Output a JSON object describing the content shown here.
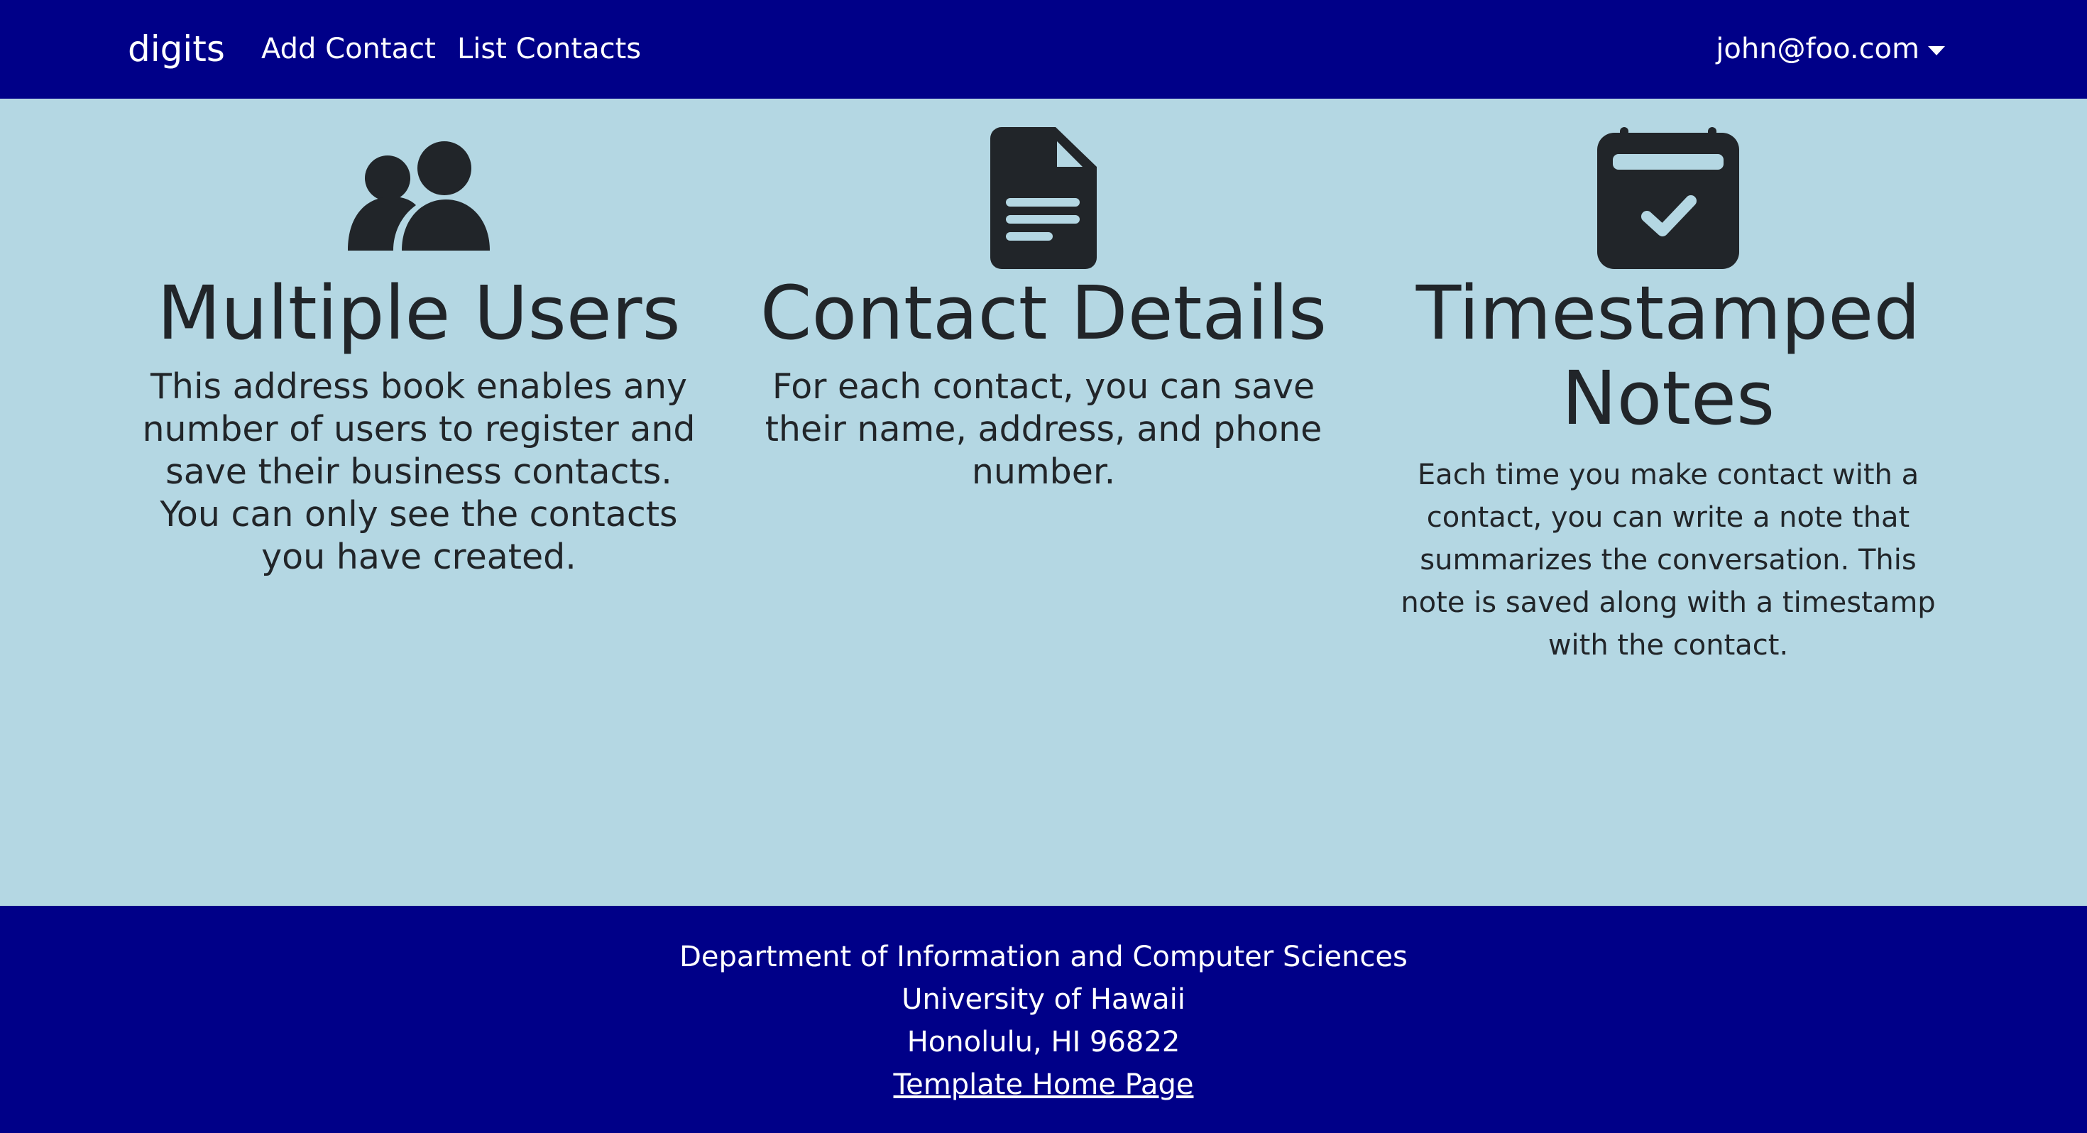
{
  "navbar": {
    "brand": "digits",
    "links": [
      {
        "label": "Add Contact"
      },
      {
        "label": "List Contacts"
      }
    ],
    "user": "john@foo.com",
    "background_color": "#000088"
  },
  "main": {
    "background_color": "#b4d7e3",
    "features": [
      {
        "icon": "users-icon",
        "title": "Multiple Users",
        "text": "This address book enables any number of users to register and save their business contacts. You can only see the contacts you have created."
      },
      {
        "icon": "file-text-icon",
        "title": "Contact Details",
        "text": "For each contact, you can save their name, address, and phone number."
      },
      {
        "icon": "calendar-check-icon",
        "title": "Timestamped Notes",
        "text": "Each time you make contact with a contact, you can write a note that summarizes the conversation. This note is saved along with a timestamp with the contact."
      }
    ]
  },
  "footer": {
    "lines": [
      "Department of Information and Computer Sciences",
      "University of Hawaii",
      "Honolulu, HI 96822"
    ],
    "link_label": "Template Home Page"
  }
}
